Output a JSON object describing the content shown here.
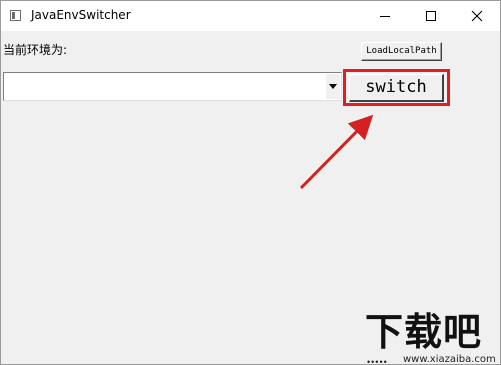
{
  "window": {
    "title": "JavaEnvSwitcher",
    "controls": {
      "minimize_icon": "minimize-icon",
      "maximize_icon": "maximize-icon",
      "close_icon": "close-icon"
    }
  },
  "main": {
    "env_label": "当前环境为:",
    "load_button_label": "LoadLocalPath",
    "env_select_value": "",
    "switch_button_label": "switch"
  },
  "annotation": {
    "highlight_color": "#e02020",
    "arrow_color": "#d42020"
  },
  "watermark": {
    "text": "下载吧",
    "url": "www.xiazaiba.com"
  }
}
